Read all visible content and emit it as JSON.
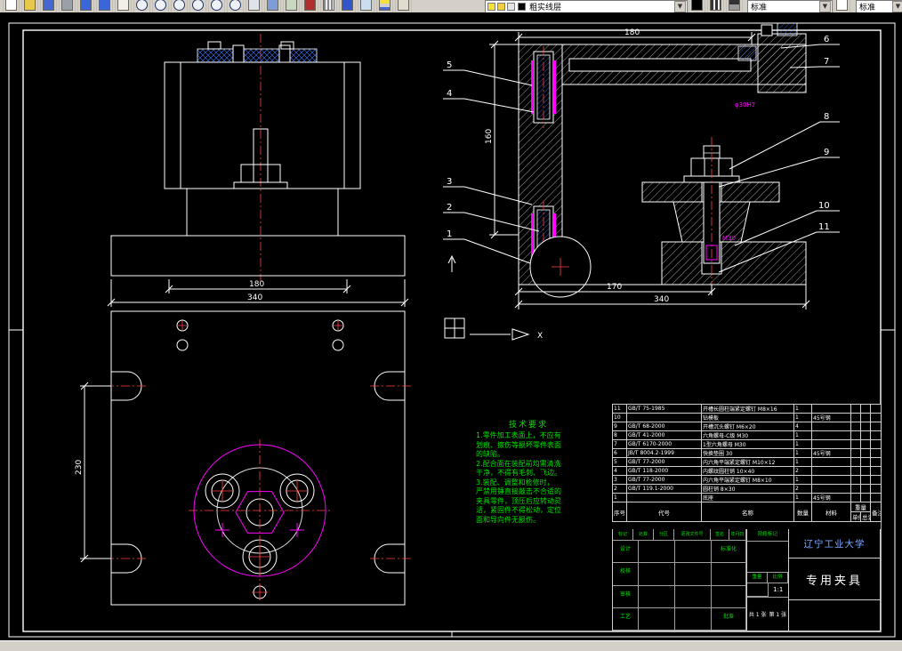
{
  "toolbar": {
    "layer_name": "粗实线层",
    "style_1": "标准",
    "style_2": "标准",
    "icons_left": [
      "qnew-icon",
      "open-icon",
      "save-icon",
      "print-icon",
      "undo-icon",
      "redo-icon",
      "pan-icon",
      "zoom-realtime-icon",
      "zoom-window-icon",
      "zoom-previous-icon",
      "zoom-in-icon",
      "zoom-out-icon",
      "zoom-extents-icon",
      "regen-icon",
      "named-views-icon",
      "3d-views-icon",
      "render-icon",
      "grid-icon",
      "help-icon",
      "properties-icon",
      "layers-icon",
      "layer-states-icon"
    ],
    "icons_mid": [
      "color-control-icon",
      "linetype-icon",
      "lineweight-icon"
    ],
    "icons_right": [
      "text-style-icon"
    ]
  },
  "drawing": {
    "front_view": {
      "dim_inner": "180",
      "dim_outer": "340"
    },
    "top_view": {
      "dim_height": "230"
    },
    "section_view": {
      "dim_top": "180",
      "dim_left": "160",
      "dim_bottom_inner": "170",
      "dim_bottom_outer": "340",
      "callout_stud": "M30",
      "callout_bush": "φ30H7",
      "axis_label": "X"
    },
    "balloons": [
      "1",
      "2",
      "3",
      "4",
      "5",
      "6",
      "7",
      "8",
      "9",
      "10",
      "11"
    ],
    "tech_req": {
      "title": "技术要求",
      "lines": [
        "1.零件加工表面上，不应有",
        "划痕、擦伤等损坏零件表面",
        "的缺陷。",
        "2.配合面在装配前均需清洗",
        "干净，不得有毛刺、飞边。",
        "3.装配、调整和检修时，",
        "严禁用锤直接敲击不合适的",
        "夹具零件，顶压后应转动灵",
        "活，紧固件不得松动，定位",
        "面和导向件无损伤。"
      ]
    }
  },
  "title_block": {
    "bom_headers": {
      "no": "序号",
      "code": "代号",
      "name": "名称",
      "qty": "数量",
      "material": "材料",
      "weight": "重量",
      "unit": "单件",
      "total": "总计",
      "note": "备注"
    },
    "bom_rows": [
      {
        "no": "11",
        "code": "GB/T 75-1985",
        "name": "开槽长圆柱端紧定螺钉 M8×16",
        "qty": "1",
        "material": "",
        "w1": "",
        "w2": "",
        "note": ""
      },
      {
        "no": "10",
        "code": "",
        "name": "钻模板",
        "qty": "1",
        "material": "45号钢",
        "w1": "",
        "w2": "",
        "note": ""
      },
      {
        "no": "9",
        "code": "GB/T 68-2000",
        "name": "开槽沉头螺钉 M6×20",
        "qty": "4",
        "material": "",
        "w1": "",
        "w2": "",
        "note": ""
      },
      {
        "no": "8",
        "code": "GB/T 41-2000",
        "name": "六角螺母-C级 M30",
        "qty": "1",
        "material": "",
        "w1": "",
        "w2": "",
        "note": ""
      },
      {
        "no": "7",
        "code": "GB/T 6170-2000",
        "name": "1型六角螺母 M30",
        "qty": "1",
        "material": "",
        "w1": "",
        "w2": "",
        "note": ""
      },
      {
        "no": "6",
        "code": "JB/T 8004.2-1999",
        "name": "快换垫圈 30",
        "qty": "1",
        "material": "45号钢",
        "w1": "",
        "w2": "",
        "note": ""
      },
      {
        "no": "5",
        "code": "GB/T 77-2000",
        "name": "内六角平端紧定螺钉 M10×12",
        "qty": "1",
        "material": "",
        "w1": "",
        "w2": "",
        "note": ""
      },
      {
        "no": "4",
        "code": "GB/T 118-2000",
        "name": "内螺纹圆柱销 10×40",
        "qty": "2",
        "material": "",
        "w1": "",
        "w2": "",
        "note": ""
      },
      {
        "no": "3",
        "code": "GB/T 77-2000",
        "name": "内六角平端紧定螺钉 M8×10",
        "qty": "1",
        "material": "",
        "w1": "",
        "w2": "",
        "note": ""
      },
      {
        "no": "2",
        "code": "GB/T 119.1-2000",
        "name": "圆柱销 8×30",
        "qty": "2",
        "material": "",
        "w1": "",
        "w2": "",
        "note": ""
      },
      {
        "no": "1",
        "code": "",
        "name": "底座",
        "qty": "1",
        "material": "45号钢",
        "w1": "",
        "w2": "",
        "note": ""
      }
    ],
    "org": "辽宁工业大学",
    "product": "专用夹具",
    "labels": {
      "mark": "标记",
      "count": "处数",
      "zone": "分区",
      "change_file": "更改文件号",
      "sign": "签名",
      "date": "年月日",
      "design": "设计",
      "check": "校核",
      "audit": "审核",
      "process": "工艺",
      "approve": "批准",
      "standardize": "标准化",
      "stage_mark": "阶段标记",
      "weight": "重量",
      "scale": "比例"
    },
    "values": {
      "scale": "1:1",
      "sheets": "共 1 张",
      "sheet_no": "第 1 张"
    }
  },
  "colors": {
    "background": "#000000",
    "line": "#ffffff",
    "hatch_blue": "#3c78ff",
    "magenta": "#ff00ff",
    "red": "#ff4040",
    "green": "#00e000",
    "toolbar_bg": "#d4d0c8",
    "org_text": "#79aaff"
  }
}
